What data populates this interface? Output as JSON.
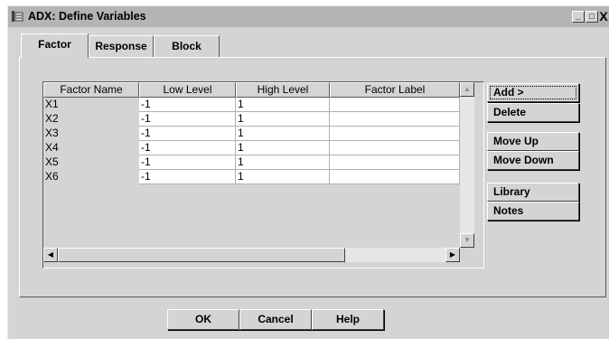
{
  "window": {
    "title": "ADX: Define Variables",
    "minimize_label": "_",
    "maximize_label": "□",
    "close_label": "X"
  },
  "tabs": [
    {
      "label": "Factor",
      "active": true
    },
    {
      "label": "Response",
      "active": false
    },
    {
      "label": "Block",
      "active": false
    }
  ],
  "table": {
    "columns": [
      "Factor Name",
      "Low Level",
      "High Level",
      "Factor Label"
    ],
    "rows": [
      {
        "name": "X1",
        "low": "-1",
        "high": "1",
        "label": ""
      },
      {
        "name": "X2",
        "low": "-1",
        "high": "1",
        "label": ""
      },
      {
        "name": "X3",
        "low": "-1",
        "high": "1",
        "label": ""
      },
      {
        "name": "X4",
        "low": "-1",
        "high": "1",
        "label": ""
      },
      {
        "name": "X5",
        "low": "-1",
        "high": "1",
        "label": ""
      },
      {
        "name": "X6",
        "low": "-1",
        "high": "1",
        "label": ""
      }
    ]
  },
  "side_buttons": {
    "add": "Add >",
    "delete": "Delete",
    "move_up": "Move Up",
    "move_down": "Move Down",
    "library": "Library",
    "notes": "Notes"
  },
  "footer_buttons": {
    "ok": "OK",
    "cancel": "Cancel",
    "help": "Help"
  },
  "icons": {
    "app": "window-app-icon",
    "scroll_up": "arrow-up-icon",
    "scroll_down": "arrow-down-icon",
    "scroll_left": "arrow-left-icon",
    "scroll_right": "arrow-right-icon"
  }
}
